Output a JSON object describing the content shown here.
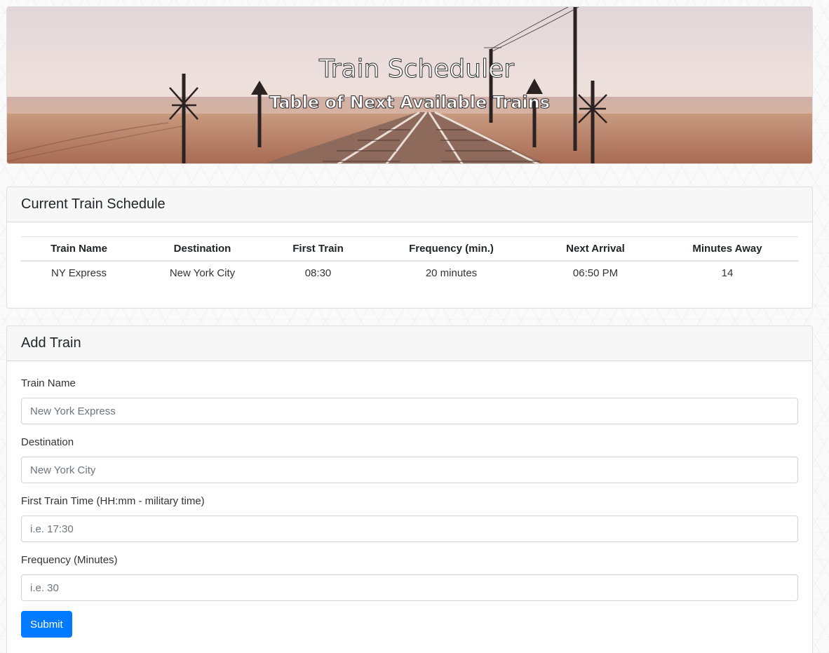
{
  "hero": {
    "title": "Train Scheduler",
    "subtitle": "Table of Next Available Trains"
  },
  "schedule": {
    "header": "Current Train Schedule",
    "columns": [
      "Train Name",
      "Destination",
      "First Train",
      "Frequency (min.)",
      "Next Arrival",
      "Minutes Away"
    ],
    "rows": [
      [
        "NY Express",
        "New York City",
        "08:30",
        "20 minutes",
        "06:50 PM",
        "14"
      ]
    ]
  },
  "add_train": {
    "header": "Add Train",
    "fields": [
      {
        "label": "Train Name",
        "placeholder": "New York Express"
      },
      {
        "label": "Destination",
        "placeholder": "New York City"
      },
      {
        "label": "First Train Time (HH:mm - military time)",
        "placeholder": "i.e. 17:30"
      },
      {
        "label": "Frequency (Minutes)",
        "placeholder": "i.e. 30"
      }
    ],
    "submit_label": "Submit"
  },
  "colors": {
    "accent": "#007bff",
    "card_header_bg": "#f7f7f7",
    "sky_top": "#e6dde0",
    "ground": "#b57a5e"
  }
}
